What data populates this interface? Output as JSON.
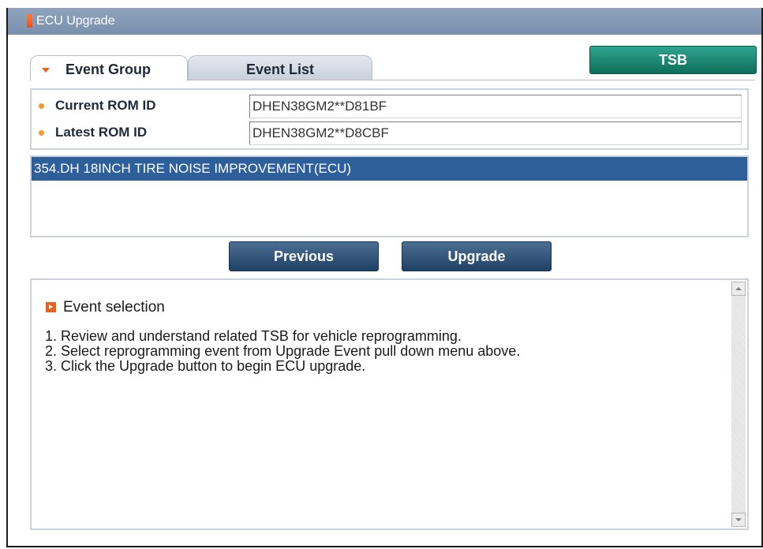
{
  "window": {
    "title": "ECU Upgrade"
  },
  "tabs": [
    {
      "label": "Event Group",
      "active": true
    },
    {
      "label": "Event List",
      "active": false
    }
  ],
  "tsb_button": {
    "label": "TSB"
  },
  "rom": {
    "current_label": "Current ROM ID",
    "current_value": "DHEN38GM2**D81BF",
    "latest_label": "Latest ROM ID",
    "latest_value": "DHEN38GM2**D8CBF"
  },
  "events": [
    {
      "label": "354.DH 18INCH TIRE NOISE IMPROVEMENT(ECU)",
      "selected": true
    }
  ],
  "buttons": {
    "previous": "Previous",
    "upgrade": "Upgrade"
  },
  "info": {
    "heading": "Event selection",
    "steps": [
      "1. Review and understand related TSB for vehicle reprogramming.",
      "2. Select reprogramming event from Upgrade Event pull down menu above.",
      "3. Click the Upgrade button to begin ECU upgrade."
    ]
  },
  "colors": {
    "title_bar": "#7f95b2",
    "tsb_button": "#18806b",
    "nav_button": "#2a4b70",
    "selection": "#2d5f9a",
    "bullet": "#f19a2a",
    "accent": "#e6631c"
  }
}
